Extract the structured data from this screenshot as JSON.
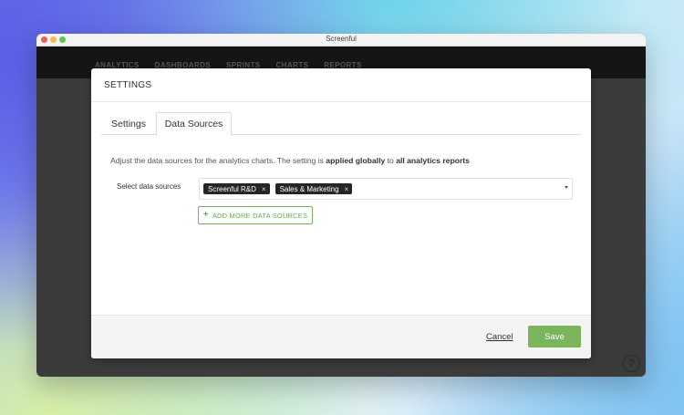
{
  "window": {
    "title": "Screenful"
  },
  "app_nav": {
    "items": [
      "ANALYTICS",
      "DASHBOARDS",
      "SPRINTS",
      "CHARTS",
      "REPORTS"
    ]
  },
  "help": {
    "icon": "question-circle-icon",
    "glyph": "?"
  },
  "modal": {
    "title": "SETTINGS",
    "tabs": [
      {
        "label": "Settings",
        "active": false
      },
      {
        "label": "Data Sources",
        "active": true
      }
    ],
    "description": {
      "prefix": "Adjust the data sources for the analytics charts. The setting is ",
      "bold1": "applied globally",
      "middle": " to ",
      "bold2": "all analytics reports"
    },
    "field_label": "Select data sources",
    "selected_sources": [
      {
        "label": "Screenful R&D",
        "remove": "×"
      },
      {
        "label": "Sales & Marketing",
        "remove": "×"
      }
    ],
    "add_button": {
      "icon": "+",
      "label": "ADD MORE DATA SOURCES"
    },
    "footer": {
      "cancel_label": "Cancel",
      "save_label": "Save"
    }
  },
  "colors": {
    "accent_green": "#7ab55c",
    "chip_bg": "#262626",
    "nav_bg": "#151515"
  }
}
